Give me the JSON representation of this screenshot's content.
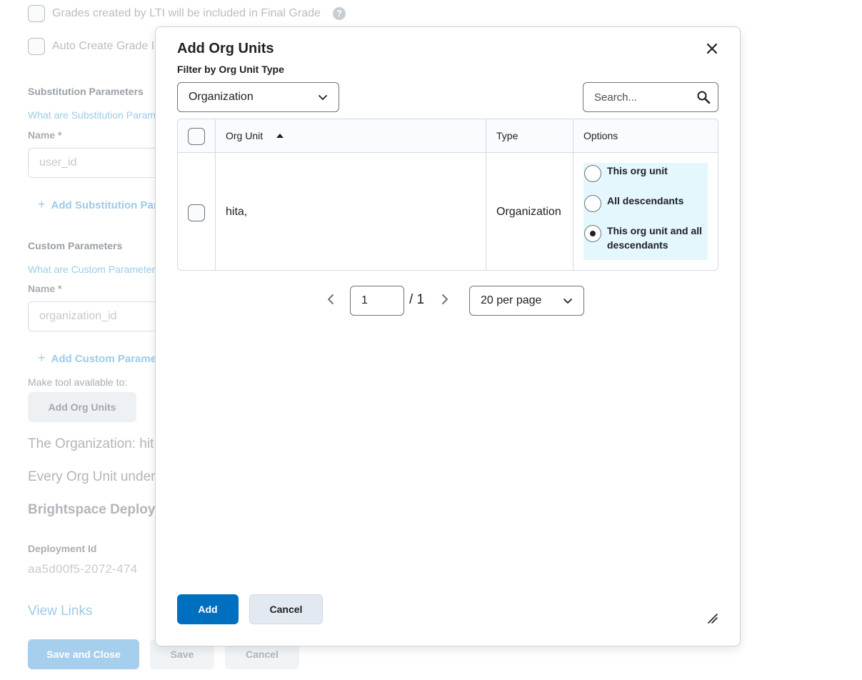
{
  "background": {
    "grades_lti_label": "Grades created by LTI will be included in Final Grade",
    "auto_create_label": "Auto Create Grade I",
    "substitution_heading": "Substitution Parameters",
    "substitution_link": "What are Substitution Param",
    "substitution_name_label": "Name *",
    "substitution_name_placeholder": "user_id",
    "add_substitution_label": "Add Substitution Para",
    "custom_heading": "Custom Parameters",
    "custom_link": "What are Custom Parameter",
    "custom_name_label": "Name *",
    "custom_name_placeholder": "organization_id",
    "add_custom_label": "Add Custom Paramete",
    "make_available_label": "Make tool available to:",
    "add_org_units_button": "Add Org Units",
    "org_line_1": "The Organization: hit",
    "org_line_2": "Every Org Unit under",
    "deployment_heading": "Brightspace Deployn",
    "deployment_id_label": "Deployment Id",
    "deployment_id_value": "aa5d00f5-2072-474",
    "view_links": "View Links",
    "save_close_button": "Save and Close",
    "save_button": "Save",
    "cancel_button": "Cancel"
  },
  "dialog": {
    "title": "Add Org Units",
    "filter_label": "Filter by Org Unit Type",
    "filter_value": "Organization",
    "search_placeholder": "Search...",
    "columns": {
      "org_unit": "Org Unit",
      "type": "Type",
      "options": "Options"
    },
    "rows": [
      {
        "org_unit": "hita,",
        "type": "Organization",
        "options": [
          "This org unit",
          "All descendants",
          "This org unit and all descendants"
        ],
        "selected_option": "This org unit and all descendants"
      }
    ],
    "pagination": {
      "current_page": "1",
      "total": "/ 1",
      "per_page": "20 per page"
    },
    "add_button": "Add",
    "cancel_button": "Cancel"
  },
  "colors": {
    "primary": "#006fbf",
    "options_highlight": "#e3f7fd",
    "link_faded": "#9fcbe8"
  },
  "icons": [
    "help-icon",
    "plus-icon",
    "close-icon",
    "chevron-down-icon",
    "search-icon",
    "sort-ascending-icon",
    "chevron-left-icon",
    "chevron-right-icon",
    "resize-handle-icon"
  ]
}
